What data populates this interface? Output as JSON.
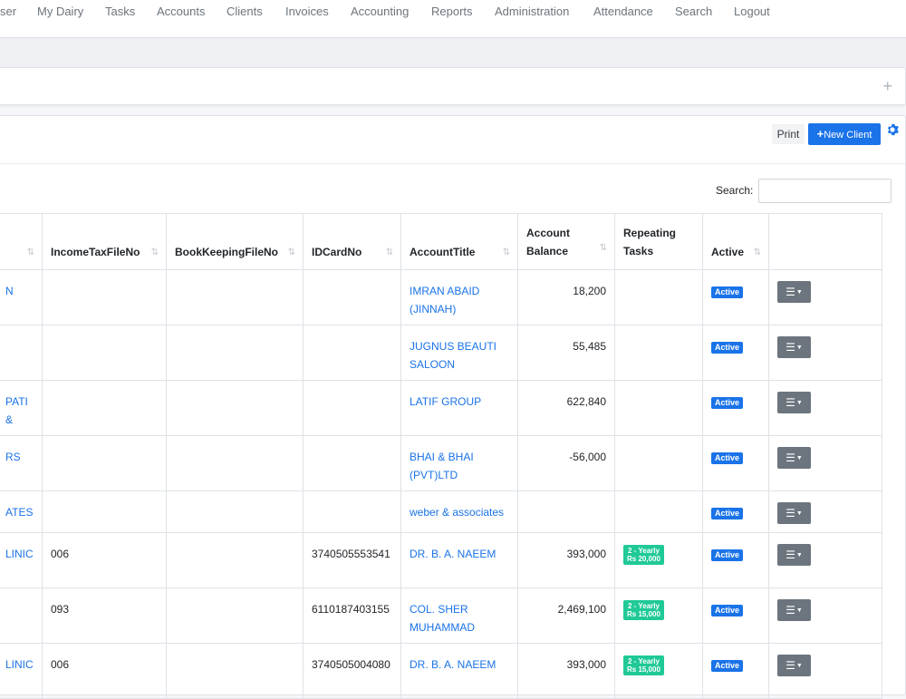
{
  "nav": [
    {
      "label": "ser"
    },
    {
      "label": "My Dairy"
    },
    {
      "label": "Tasks"
    },
    {
      "label": "Accounts"
    },
    {
      "label": "Clients"
    },
    {
      "label": "Invoices"
    },
    {
      "label": "Accounting"
    },
    {
      "label": "Reports"
    },
    {
      "label": "Administration"
    },
    {
      "label": "Attendance"
    },
    {
      "label": "Search"
    },
    {
      "label": "Logout"
    }
  ],
  "filter": {
    "expand_icon": "plus-icon"
  },
  "toolbar": {
    "print_label": "Print",
    "new_client_label": "New Client",
    "settings_icon": "gear-icon"
  },
  "search": {
    "label": "Search:",
    "value": ""
  },
  "table": {
    "columns": [
      "IncomeTaxFileNo",
      "BookKeepingFileNo",
      "IDCardNo",
      "AccountTitle",
      "Account Balance",
      "Repeating Tasks",
      "Active"
    ],
    "rows": [
      {
        "name": "N",
        "income_tax": "",
        "bookkeeping": "",
        "id_card": "",
        "title": "IMRAN ABAID (JINNAH)",
        "balance": "18,200",
        "task": "",
        "active": "Active"
      },
      {
        "name": "",
        "income_tax": "",
        "bookkeeping": "",
        "id_card": "",
        "title": "JUGNUS BEAUTI SALOON",
        "balance": "55,485",
        "task": "",
        "active": "Active"
      },
      {
        "name": "PATI &",
        "income_tax": "",
        "bookkeeping": "",
        "id_card": "",
        "title": "LATIF GROUP",
        "balance": "622,840",
        "task": "",
        "active": "Active"
      },
      {
        "name": "RS",
        "income_tax": "",
        "bookkeeping": "",
        "id_card": "",
        "title": "BHAI & BHAI (PVT)LTD",
        "balance": "-56,000",
        "task": "",
        "active": "Active"
      },
      {
        "name": "ATES",
        "income_tax": "",
        "bookkeeping": "",
        "id_card": "",
        "title": "weber & associates",
        "balance": "",
        "task": "",
        "active": "Active"
      },
      {
        "name": "LINIC",
        "income_tax": "006",
        "bookkeeping": "",
        "id_card": "3740505553541",
        "title": "DR. B. A. NAEEM",
        "balance": "393,000",
        "task_line1": "2 - Yearly",
        "task_line2": "Rs 20,000",
        "active": "Active"
      },
      {
        "name": "",
        "income_tax": "093",
        "bookkeeping": "",
        "id_card": "6110187403155",
        "title": "COL. SHER MUHAMMAD",
        "balance": "2,469,100",
        "task_line1": "2 - Yearly",
        "task_line2": "Rs 15,000",
        "active": "Active"
      },
      {
        "name": "LINIC",
        "income_tax": "006",
        "bookkeeping": "",
        "id_card": "3740505004080",
        "title": "DR. B. A. NAEEM",
        "balance": "393,000",
        "task_line1": "2 - Yearly",
        "task_line2": "Rs 15,000",
        "active": "Active"
      }
    ]
  },
  "colors": {
    "link": "#1a73e8",
    "active_badge": "#1a73e8",
    "task_badge": "#20c997",
    "action_button": "#6c757d"
  }
}
